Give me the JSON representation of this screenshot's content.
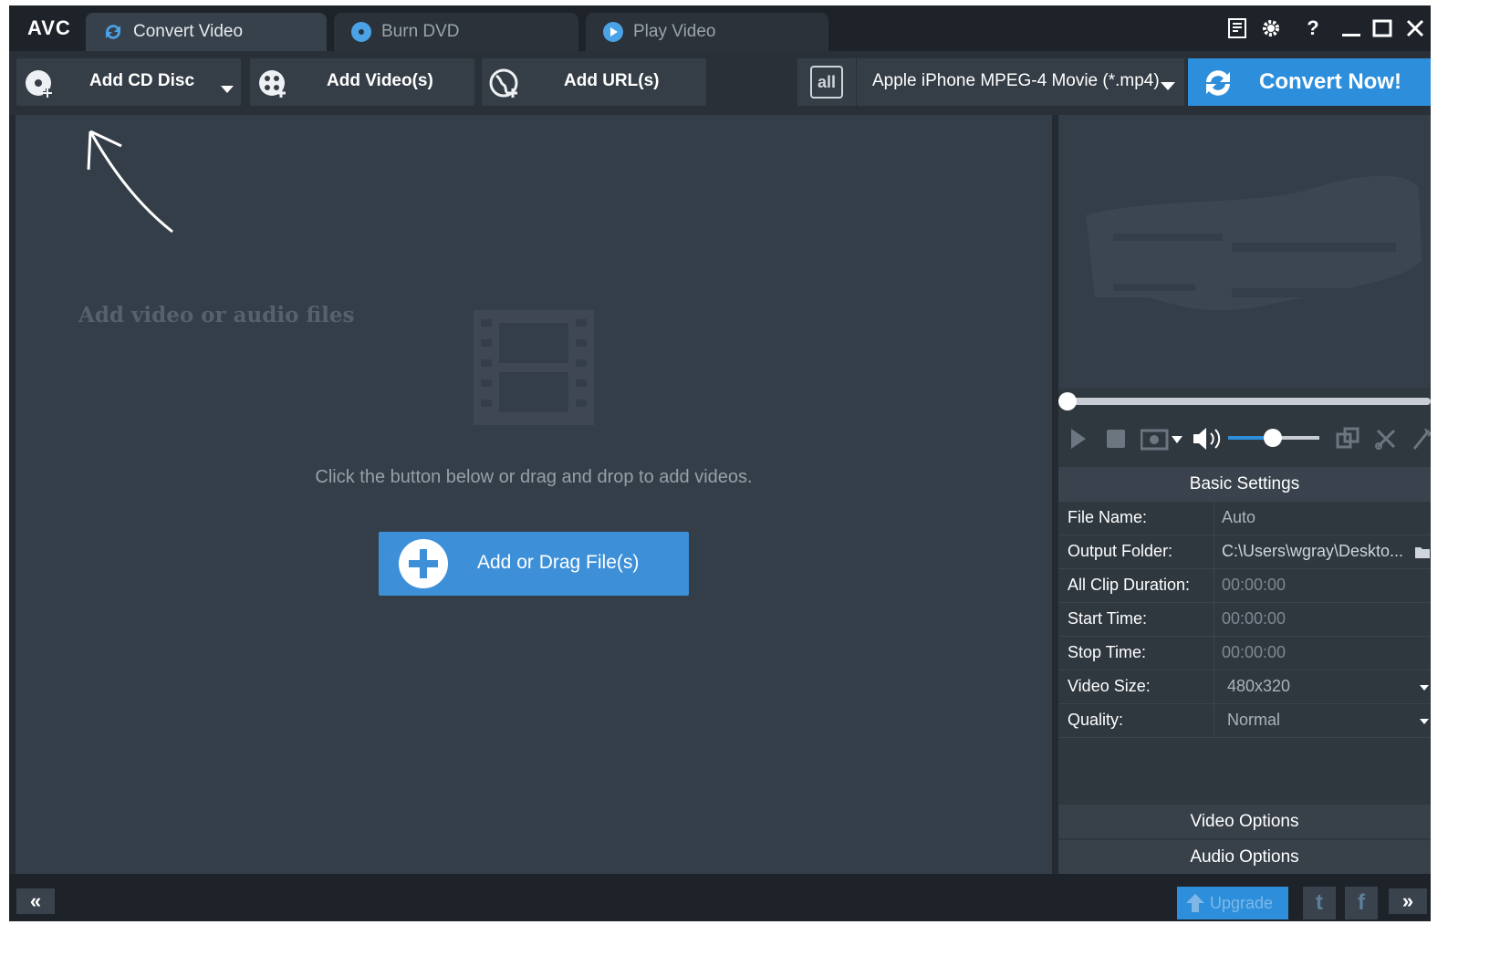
{
  "app": {
    "logo": "AVC"
  },
  "tabs": [
    {
      "label": "Convert Video",
      "active": true,
      "icon": "convert-icon"
    },
    {
      "label": "Burn DVD",
      "active": false,
      "icon": "disc-icon"
    },
    {
      "label": "Play Video",
      "active": false,
      "icon": "play-icon"
    }
  ],
  "window_controls": {
    "help_label": "?"
  },
  "toolbar": {
    "add_cd": "Add CD Disc",
    "add_videos": "Add Video(s)",
    "add_urls": "Add URL(s)",
    "profile_icon_text": "all",
    "profile": "Apple iPhone MPEG-4 Movie (*.mp4)",
    "convert": "Convert Now!"
  },
  "main": {
    "hint_title": "Add video or audio files",
    "drag_hint": "Click the button below or drag and drop to add videos.",
    "add_button": "Add or Drag File(s)"
  },
  "player": {
    "seek_position": 0.0,
    "volume": 0.5
  },
  "settings": {
    "title": "Basic Settings",
    "rows": [
      {
        "key": "File Name:",
        "value": "Auto"
      },
      {
        "key": "Output Folder:",
        "value": "C:\\Users\\wgray\\Deskto..."
      },
      {
        "key": "All Clip Duration:",
        "value": "00:00:00"
      },
      {
        "key": "Start Time:",
        "value": "00:00:00"
      },
      {
        "key": "Stop Time:",
        "value": "00:00:00"
      },
      {
        "key": "Video Size:",
        "value": "480x320"
      },
      {
        "key": "Quality:",
        "value": "Normal"
      }
    ],
    "video_options": "Video Options",
    "audio_options": "Audio Options"
  },
  "bottom": {
    "collapse": "«",
    "upgrade": "Upgrade",
    "twitter": "t",
    "facebook": "f",
    "expand": "»"
  },
  "colors": {
    "accent": "#2d8fdb",
    "background": "#343e48",
    "titlebar": "#1d2329"
  }
}
